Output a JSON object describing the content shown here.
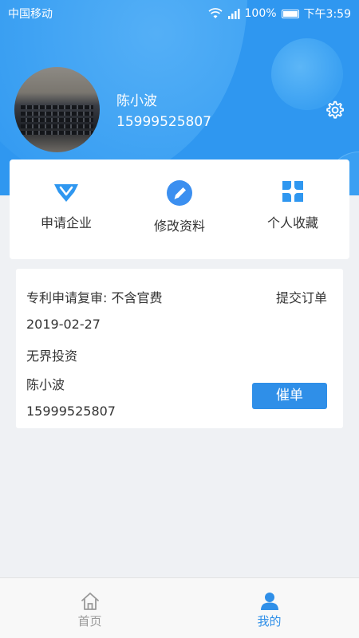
{
  "status_bar": {
    "carrier": "中国移动",
    "battery": "100%",
    "time": "下午3:59"
  },
  "profile": {
    "name": "陈小波",
    "phone": "15999525807"
  },
  "menu": {
    "items": [
      {
        "label": "申请企业",
        "icon": "vip-diamond-icon"
      },
      {
        "label": "修改资料",
        "icon": "edit-pencil-icon"
      },
      {
        "label": "个人收藏",
        "icon": "clover-icon"
      }
    ]
  },
  "order": {
    "title": "专利申请复审: 不含官费",
    "status": "提交订单",
    "date": "2019-02-27",
    "company": "无界投资",
    "contact": "陈小波",
    "phone": "15999525807",
    "action_label": "催单"
  },
  "tabbar": {
    "tabs": [
      {
        "label": "首页",
        "icon": "home-icon",
        "active": false
      },
      {
        "label": "我的",
        "icon": "user-icon",
        "active": true
      }
    ]
  },
  "colors": {
    "primary": "#2f97f0",
    "button": "#2f8fe8",
    "tab_active": "#2f8fe8",
    "tab_inactive": "#999999"
  }
}
